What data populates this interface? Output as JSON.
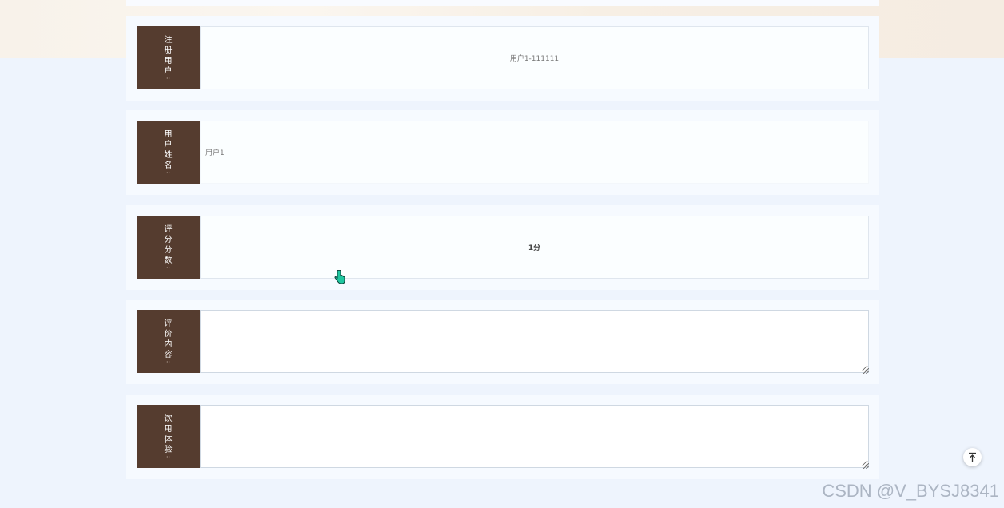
{
  "form": {
    "rows": [
      {
        "label": "注册用户",
        "value": "用户1-111111",
        "kind": "readonly-center"
      },
      {
        "label": "用户姓名",
        "value": "用户1",
        "kind": "readonly-left"
      },
      {
        "label": "评分分数",
        "value": "1分",
        "kind": "readonly-center-bold"
      },
      {
        "label": "评价内容",
        "value": "",
        "kind": "textarea"
      },
      {
        "label": "饮用体验",
        "value": "",
        "kind": "textarea"
      }
    ]
  },
  "watermark": "CSDN @V_BYSJ8341",
  "icons": {
    "scroll_top": "arrow-up-to-top-icon",
    "pointer": "hand-pointer-cursor-icon"
  },
  "colors": {
    "label_bg": "#553c2f",
    "page_bg": "#eef4fd",
    "row_bg": "#f6faff"
  }
}
